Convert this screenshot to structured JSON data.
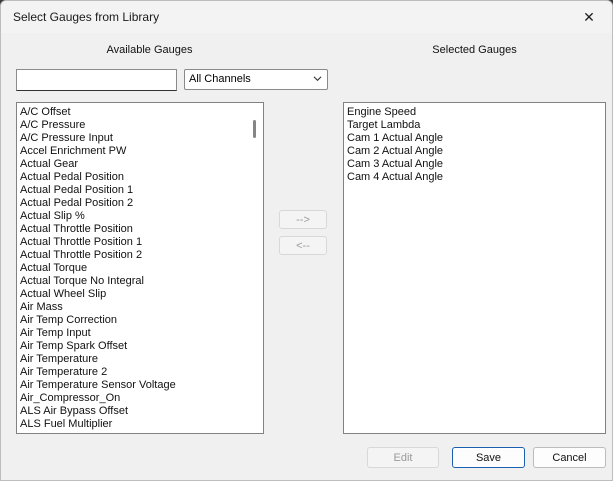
{
  "window": {
    "title": "Select Gauges from Library",
    "close_glyph": "✕"
  },
  "available": {
    "heading": "Available Gauges",
    "search_value": "",
    "filter_selected": "All Channels",
    "items": [
      "A/C Offset",
      "A/C Pressure",
      "A/C Pressure Input",
      "Accel Enrichment PW",
      "Actual Gear",
      "Actual Pedal Position",
      "Actual Pedal Position 1",
      "Actual Pedal Position 2",
      "Actual Slip %",
      "Actual Throttle Position",
      "Actual Throttle Position 1",
      "Actual Throttle Position 2",
      "Actual Torque",
      "Actual Torque No Integral",
      "Actual Wheel Slip",
      "Air Mass",
      "Air Temp Correction",
      "Air Temp Input",
      "Air Temp Spark Offset",
      "Air Temperature",
      "Air Temperature 2",
      "Air Temperature Sensor Voltage",
      "Air_Compressor_On",
      "ALS Air Bypass Offset",
      "ALS Fuel Multiplier"
    ]
  },
  "selected": {
    "heading": "Selected Gauges",
    "items": [
      "Engine Speed",
      "Target Lambda",
      "Cam 1 Actual Angle",
      "Cam 2 Actual Angle",
      "Cam 3 Actual Angle",
      "Cam 4 Actual Angle"
    ]
  },
  "transfer": {
    "add_label": "-->",
    "remove_label": "<--"
  },
  "footer": {
    "edit_label": "Edit",
    "save_label": "Save",
    "cancel_label": "Cancel"
  },
  "icons": {
    "close": "close-icon",
    "dropdown": "chevron-down-icon"
  },
  "colors": {
    "dialog_bg": "#f0f0f0",
    "primary_button_border": "#1b5fb0",
    "disabled_text": "#9a9a9a"
  }
}
